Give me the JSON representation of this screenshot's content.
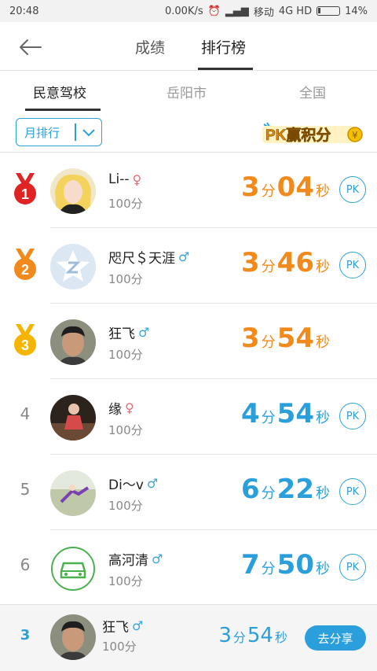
{
  "status_bar": {
    "time": "20:48",
    "speed": "0.00K/s",
    "carrier": "移动",
    "network": "4G HD",
    "battery": "14%"
  },
  "header": {
    "tab_scores": "成绩",
    "tab_ranking": "排行榜"
  },
  "subtabs": [
    "民意驾校",
    "岳阳市",
    "全国"
  ],
  "filter": {
    "dropdown_value": "月排行",
    "promo_logo": "PK赢积分"
  },
  "rows": [
    {
      "rank": "1",
      "name": "Li‐‐",
      "gender": "♀",
      "score": "100分",
      "min": "3",
      "min_unit": "分",
      "sec": "04",
      "sec_unit": "秒",
      "pk": "PK"
    },
    {
      "rank": "2",
      "name": "咫尺＄天涯",
      "gender": "♂",
      "score": "100分",
      "min": "3",
      "min_unit": "分",
      "sec": "46",
      "sec_unit": "秒",
      "pk": "PK"
    },
    {
      "rank": "3",
      "name": "狂飞",
      "gender": "♂",
      "score": "100分",
      "min": "3",
      "min_unit": "分",
      "sec": "54",
      "sec_unit": "秒",
      "pk": ""
    },
    {
      "rank": "4",
      "name": "缘",
      "gender": "♀",
      "score": "100分",
      "min": "4",
      "min_unit": "分",
      "sec": "54",
      "sec_unit": "秒",
      "pk": "PK"
    },
    {
      "rank": "5",
      "name": "Di～v",
      "gender": "♂",
      "score": "100分",
      "min": "6",
      "min_unit": "分",
      "sec": "22",
      "sec_unit": "秒",
      "pk": "PK"
    },
    {
      "rank": "6",
      "name": "高河清",
      "gender": "♂",
      "score": "100分",
      "min": "7",
      "min_unit": "分",
      "sec": "50",
      "sec_unit": "秒",
      "pk": "PK"
    }
  ],
  "my_rank": {
    "rank": "3",
    "name": "狂飞",
    "gender": "♂",
    "score": "100分",
    "min": "3",
    "min_unit": "分",
    "sec": "54",
    "sec_unit": "秒",
    "share_label": "去分享"
  },
  "colors": {
    "accent": "#2b9fdc",
    "top3_time": "#f08a1c",
    "gold": "#f4b400",
    "silver_orange": "#f08a1c",
    "first_red": "#e02424"
  }
}
